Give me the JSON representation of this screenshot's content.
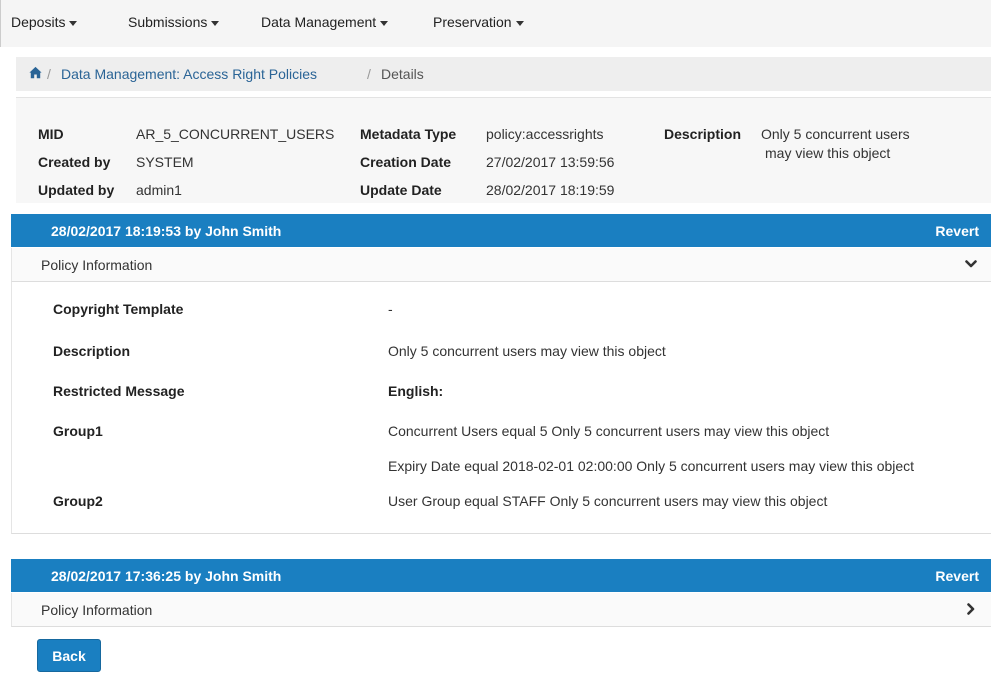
{
  "nav": {
    "items": [
      {
        "label": "Deposits"
      },
      {
        "label": "Submissions"
      },
      {
        "label": "Data Management"
      },
      {
        "label": "Preservation"
      }
    ]
  },
  "breadcrumb": {
    "home_icon": "home-icon",
    "section": "Data Management: Access Right Policies",
    "separator": "/",
    "current": "Details"
  },
  "meta": {
    "mid_label": "MID",
    "mid_value": "AR_5_CONCURRENT_USERS",
    "created_by_label": "Created by",
    "created_by_value": "SYSTEM",
    "updated_by_label": "Updated by",
    "updated_by_value": "admin1",
    "metadata_type_label": "Metadata Type",
    "metadata_type_value": "policy:accessrights",
    "creation_date_label": "Creation Date",
    "creation_date_value": "27/02/2017 13:59:56",
    "update_date_label": "Update Date",
    "update_date_value": "28/02/2017 18:19:59",
    "description_label": "Description",
    "description_line1": "Only 5 concurrent users",
    "description_line2": "may view this object"
  },
  "history": [
    {
      "header": "28/02/2017 18:19:53 by John Smith",
      "revert_label": "Revert",
      "panel_title": "Policy Information",
      "expanded": true,
      "chevron_icon": "chevron-down-icon",
      "rows": {
        "copyright_label": "Copyright Template",
        "copyright_value": "-",
        "description_label": "Description",
        "description_value": "Only 5 concurrent users may view this object",
        "restricted_label": "Restricted Message",
        "restricted_value": "English:",
        "group1_label": "Group1",
        "group1_value1": "Concurrent Users equal 5 Only 5 concurrent users may view this object",
        "group1_value2": "Expiry Date equal 2018-02-01 02:00:00 Only 5 concurrent users may view this object",
        "group2_label": "Group2",
        "group2_value": "User Group equal STAFF Only 5 concurrent users may view this object"
      }
    },
    {
      "header": "28/02/2017 17:36:25 by John Smith",
      "revert_label": "Revert",
      "panel_title": "Policy Information",
      "expanded": false,
      "chevron_icon": "chevron-right-icon"
    }
  ],
  "back_label": "Back",
  "colors": {
    "accent": "#1a7fc1",
    "link": "#2a6496"
  }
}
